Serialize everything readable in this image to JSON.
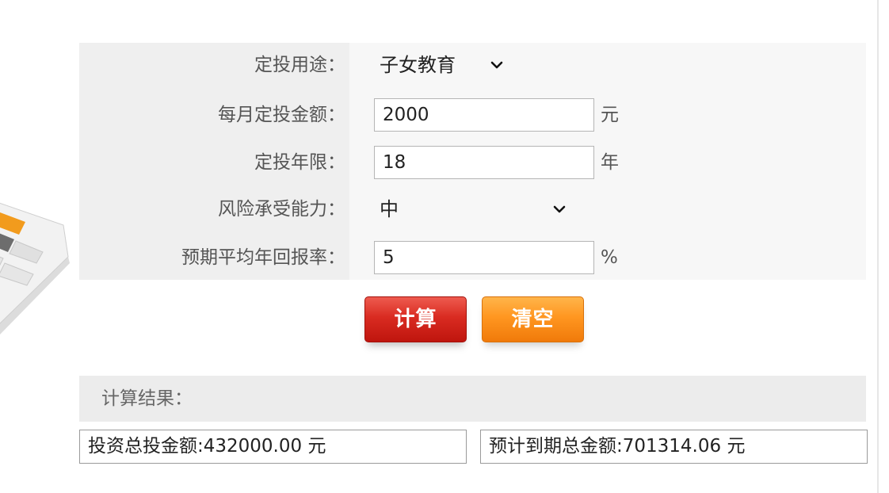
{
  "form": {
    "purpose": {
      "label": "定投用途：",
      "value": "子女教育"
    },
    "monthly_amount": {
      "label": "每月定投金额：",
      "value": "2000",
      "unit": "元"
    },
    "years": {
      "label": "定投年限：",
      "value": "18",
      "unit": "年"
    },
    "risk": {
      "label": "风险承受能力：",
      "value": "中"
    },
    "return_rate": {
      "label": "预期平均年回报率：",
      "value": "5",
      "unit": "%"
    }
  },
  "buttons": {
    "calculate": "计算",
    "clear": "清空"
  },
  "result": {
    "title": "计算结果：",
    "total_invested": "投资总投金额:432000.00 元",
    "total_maturity": "预计到期总金额:701314.06 元"
  },
  "colors": {
    "calculate_button": "#d92b21",
    "clear_button": "#ff9620",
    "panel_background": "#f7f7f7",
    "label_background": "#efefef"
  },
  "icons": {
    "select_arrow": "chevron-down-icon",
    "illustration": "calculator-illustration"
  }
}
